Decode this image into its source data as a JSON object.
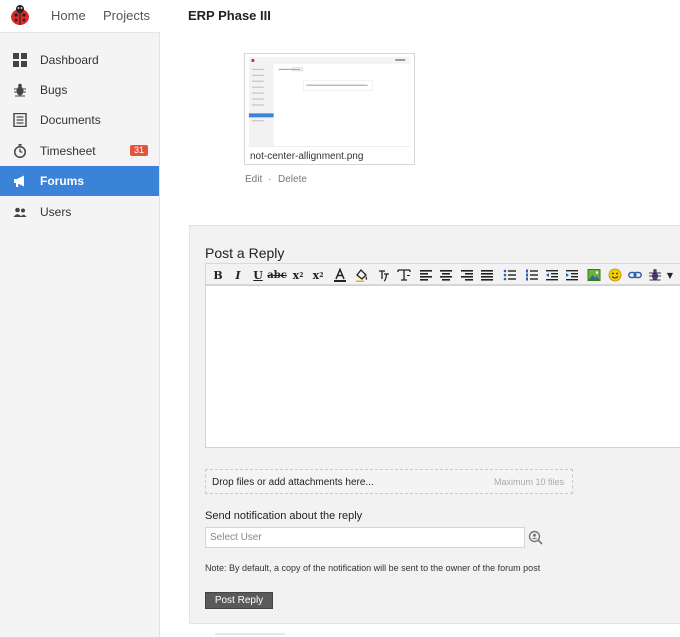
{
  "topbar": {
    "home_label": "Home",
    "projects_label": "Projects",
    "project_title": "ERP Phase III"
  },
  "sidebar": {
    "items": [
      {
        "label": "Dashboard",
        "icon": "dashboard-grid-icon"
      },
      {
        "label": "Bugs",
        "icon": "bug-icon"
      },
      {
        "label": "Documents",
        "icon": "document-icon"
      },
      {
        "label": "Timesheet",
        "icon": "stopwatch-icon",
        "badge": "31"
      },
      {
        "label": "Forums",
        "icon": "megaphone-icon",
        "active": true
      },
      {
        "label": "Users",
        "icon": "users-icon"
      }
    ]
  },
  "attachment": {
    "file_name": "not-center-allignment.png",
    "edit_label": "Edit",
    "separator": "·",
    "delete_label": "Delete"
  },
  "reply": {
    "title": "Post a Reply",
    "toolbar_icons": [
      "bold-icon",
      "italic-icon",
      "underline-icon",
      "strikethrough-icon",
      "subscript-icon",
      "superscript-icon",
      "font-color-icon",
      "highlight-icon",
      "font-family-icon",
      "font-size-icon",
      "align-left-icon",
      "align-center-icon",
      "align-right-icon",
      "justify-icon",
      "bullet-list-icon",
      "numbered-list-icon",
      "outdent-icon",
      "indent-icon",
      "image-icon",
      "emoji-icon",
      "link-icon",
      "bug-icon",
      "dropdown-arrow-icon"
    ],
    "dropzone_label": "Drop files or add attachments here...",
    "dropzone_max": "Maximum 10 files",
    "notify_label": "Send notification about the reply",
    "user_placeholder": "Select User",
    "note": "Note: By default, a copy of the notification will be sent to the owner of the forum post",
    "post_button": "Post Reply"
  },
  "colors": {
    "accent": "#3b82d9",
    "badge": "#e2553b",
    "button": "#5a5a5a"
  }
}
